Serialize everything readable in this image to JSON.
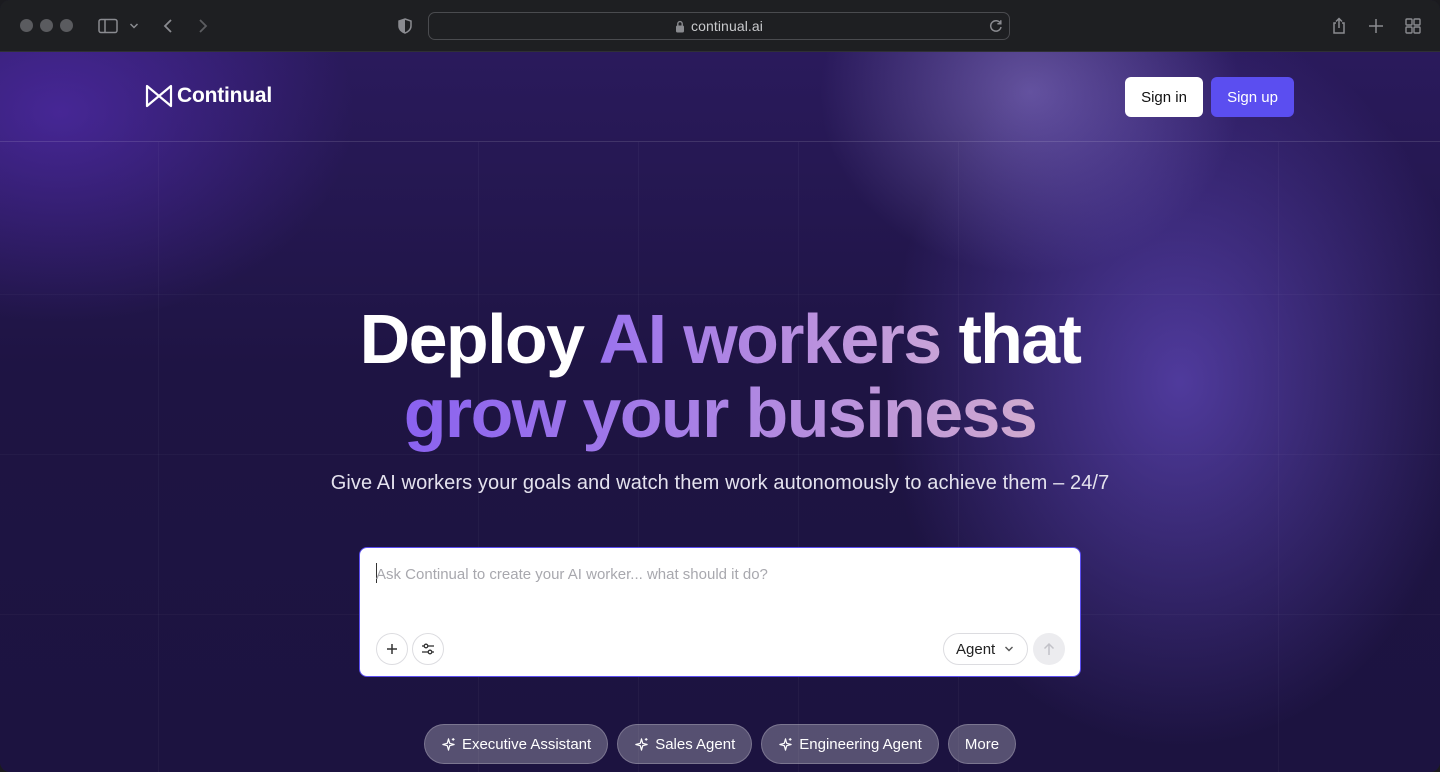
{
  "browser": {
    "url": "continual.ai"
  },
  "nav": {
    "logo_text": "Continual",
    "signin_label": "Sign in",
    "signup_label": "Sign up"
  },
  "hero": {
    "line1_a": "Deploy ",
    "line1_b": "AI workers",
    "line1_c": " that",
    "line2": "grow your business",
    "subtitle": "Give AI workers your goals and watch them work autonomously to achieve them – 24/7"
  },
  "prompt": {
    "placeholder": "Ask Continual to create your AI worker... what should it do?",
    "value": "",
    "mode_label": "Agent"
  },
  "chips": [
    {
      "label": "Executive Assistant",
      "icon": "sparkle-icon"
    },
    {
      "label": "Sales Agent",
      "icon": "sparkle-icon"
    },
    {
      "label": "Engineering Agent",
      "icon": "sparkle-icon"
    },
    {
      "label": "More"
    }
  ],
  "colors": {
    "accent": "#5b4ef0",
    "background": "#1e1443",
    "gradient_start": "#8a62f0",
    "gradient_end": "#d0aacf"
  }
}
